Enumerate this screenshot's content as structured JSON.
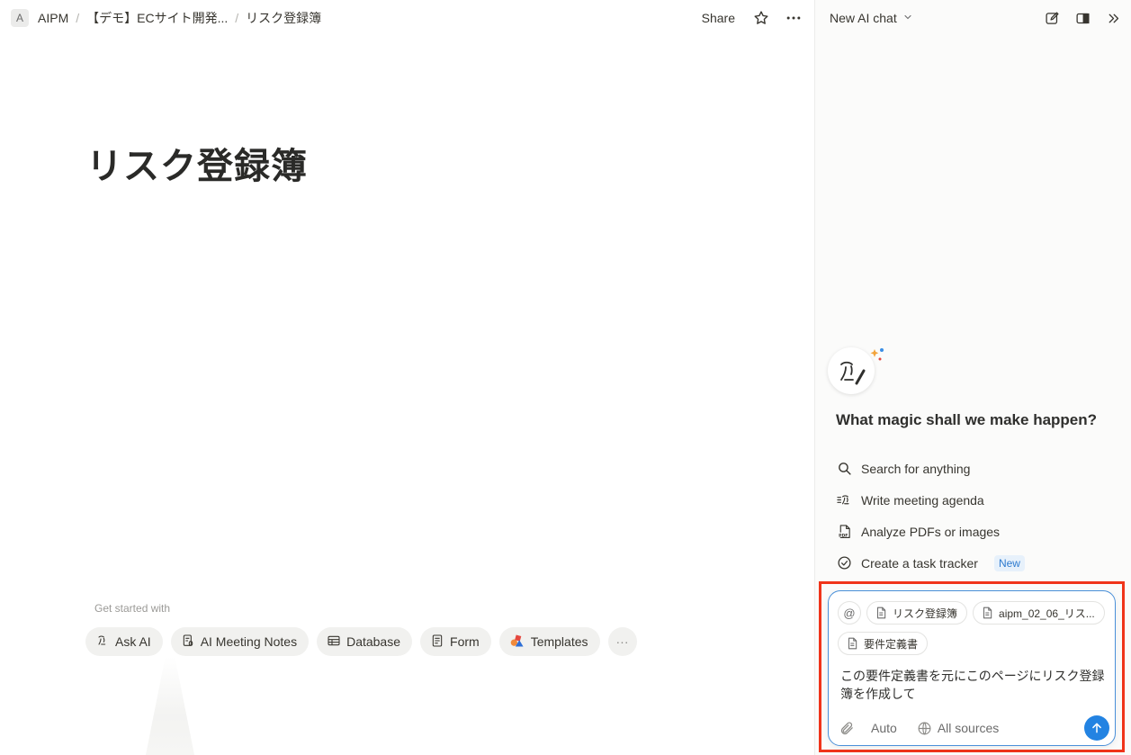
{
  "breadcrumb": {
    "avatar_letter": "A",
    "items": [
      "AIPM",
      "【デモ】ECサイト開発...",
      "リスク登録簿"
    ],
    "separator": "/"
  },
  "topbar": {
    "share_label": "Share"
  },
  "page": {
    "title": "リスク登録簿"
  },
  "get_started": {
    "heading": "Get started with",
    "chips": [
      "Ask AI",
      "AI Meeting Notes",
      "Database",
      "Form",
      "Templates"
    ],
    "more_label": "···"
  },
  "ai_panel": {
    "title": "New AI chat",
    "welcome": "What magic shall we make happen?",
    "suggestions": [
      {
        "label": "Search for anything",
        "icon": "search-icon"
      },
      {
        "label": "Write meeting agenda",
        "icon": "agenda-icon"
      },
      {
        "label": "Analyze PDFs or images",
        "icon": "pdf-icon"
      },
      {
        "label": "Create a task tracker",
        "icon": "check-circle-icon",
        "badge": "New"
      }
    ],
    "composer": {
      "mention_symbol": "@",
      "context_chips": [
        "リスク登録簿",
        "aipm_02_06_リス...",
        "要件定義書"
      ],
      "prompt_text": "この要件定義書を元にこのページにリスク登録簿を作成して",
      "mode_label": "Auto",
      "sources_label": "All sources"
    }
  },
  "colors": {
    "accent_blue": "#2383e2",
    "highlight_red": "#f0341a",
    "badge_blue": "#2e7bcf"
  }
}
